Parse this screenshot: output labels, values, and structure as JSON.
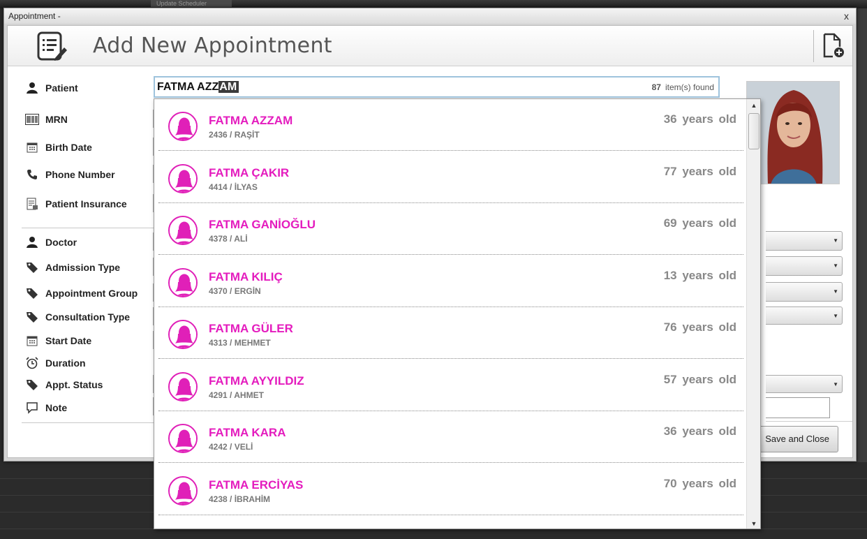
{
  "background": {
    "tab_label": "Update Scheduler"
  },
  "window": {
    "title": "Appointment -",
    "close_label": "x"
  },
  "header": {
    "title": "Add New Appointment",
    "icon": "document-edit-icon",
    "new_icon": "new-document-icon"
  },
  "form": {
    "patient_label": "Patient",
    "mrn_label": "MRN",
    "birth_date_label": "Birth Date",
    "phone_label": "Phone Number",
    "insurance_label": "Patient Insurance",
    "doctor_label": "Doctor",
    "admission_type_label": "Admission Type",
    "appointment_group_label": "Appointment Group",
    "consultation_type_label": "Consultation Type",
    "start_date_label": "Start Date",
    "duration_label": "Duration",
    "appt_status_label": "Appt. Status",
    "note_label": "Note"
  },
  "search": {
    "typed": "FATMA AZZ",
    "autocomplete": "AM",
    "count": "87",
    "count_suffix": "item(s) found"
  },
  "results": [
    {
      "name": "FATMA AZZAM",
      "sub": "2436 / RAŞİT",
      "age": "36 years  old"
    },
    {
      "name": "FATMA ÇAKIR",
      "sub": "4414 / İLYAS",
      "age": "77 years  old"
    },
    {
      "name": "FATMA GANİOĞLU",
      "sub": "4378 / ALİ",
      "age": "69 years  old"
    },
    {
      "name": "FATMA KILIÇ",
      "sub": "4370 / ERGİN",
      "age": "13 years  old"
    },
    {
      "name": "FATMA GÜLER",
      "sub": "4313 / MEHMET",
      "age": "76 years  old"
    },
    {
      "name": "FATMA AYYILDIZ",
      "sub": "4291 / AHMET",
      "age": "57 years  old"
    },
    {
      "name": "FATMA KARA",
      "sub": "4242 / VELİ",
      "age": "36 years  old"
    },
    {
      "name": "FATMA ERCİYAS",
      "sub": "4238 / İBRAHİM",
      "age": "70 years  old"
    }
  ],
  "actions": {
    "save_close": "Save and Close"
  },
  "colors": {
    "accent_name": "#e41cbe",
    "input_border": "#9ec3dd"
  }
}
